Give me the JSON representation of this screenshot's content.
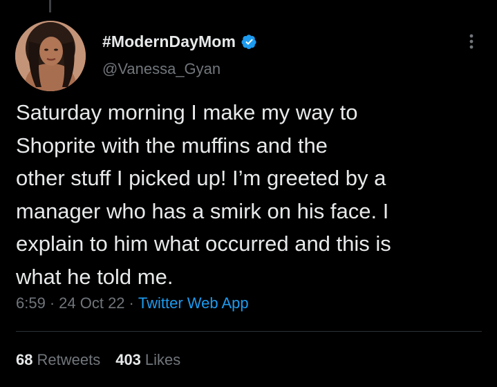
{
  "tweet": {
    "author": {
      "display_name": "#ModernDayMom",
      "handle": "@Vanessa_Gyan",
      "verified": true,
      "verified_color": "#1d9bf0"
    },
    "text": "Saturday morning I make my way to\nShoprite with the muffins and the\nother stuff I picked up! I’m greeted by a\nmanager who has a smirk on his face. I\nexplain to him what occurred and this is\nwhat he told me.",
    "time": "6:59",
    "date": "24 Oct 22",
    "separator": "·",
    "source": "Twitter Web App",
    "retweets": {
      "count": "68",
      "label": "Retweets"
    },
    "likes": {
      "count": "403",
      "label": "Likes"
    }
  },
  "icons": {
    "more": "more-vertical-icon",
    "verified": "verified-badge-icon"
  },
  "colors": {
    "background": "#000000",
    "text_primary": "#e7e9ea",
    "text_secondary": "#71767b",
    "link": "#1d9bf0",
    "divider": "#2f3336"
  }
}
